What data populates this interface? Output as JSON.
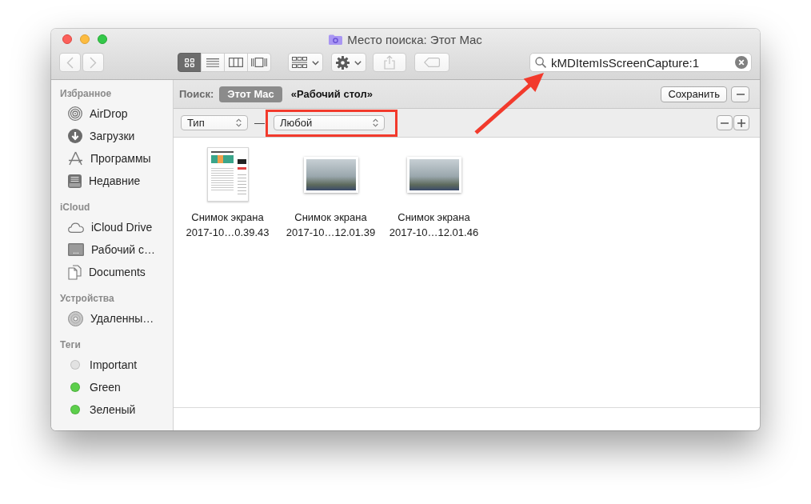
{
  "window": {
    "title": "Место поиска: Этот Mac"
  },
  "toolbar": {
    "nav": [
      {
        "kind": "back",
        "disabled": true
      },
      {
        "kind": "forward",
        "disabled": true
      }
    ],
    "views": [
      {
        "kind": "icons",
        "selected": true
      },
      {
        "kind": "list",
        "selected": false
      },
      {
        "kind": "columns",
        "selected": false
      },
      {
        "kind": "gallery",
        "selected": false
      }
    ],
    "buttons": [
      {
        "kind": "arrange",
        "disabled": false
      },
      {
        "kind": "action",
        "disabled": false
      },
      {
        "kind": "share",
        "disabled": true
      },
      {
        "kind": "tags",
        "disabled": true
      }
    ],
    "search": {
      "value": "kMDItemIsScreenCapture:1"
    }
  },
  "sidebar": {
    "sections": [
      {
        "title": "Избранное",
        "items": [
          {
            "label": "AirDrop",
            "kind": "airdrop"
          },
          {
            "label": "Загрузки",
            "kind": "downloads"
          },
          {
            "label": "Программы",
            "kind": "applications"
          },
          {
            "label": "Недавние",
            "kind": "recents"
          }
        ]
      },
      {
        "title": "iCloud",
        "items": [
          {
            "label": "iCloud Drive",
            "kind": "cloud"
          },
          {
            "label": "Рабочий с…",
            "kind": "desktop"
          },
          {
            "label": "Documents",
            "kind": "documents"
          }
        ]
      },
      {
        "title": "Устройства",
        "items": [
          {
            "label": "Удаленны…",
            "kind": "disc"
          }
        ]
      },
      {
        "title": "Теги",
        "items": [
          {
            "label": "Important",
            "kind": "tag",
            "color": "#e2e2e2"
          },
          {
            "label": "Green",
            "kind": "tag",
            "color": "#5ccf4b"
          },
          {
            "label": "Зеленый",
            "kind": "tag",
            "color": "#5ccf4b"
          }
        ]
      }
    ]
  },
  "scope_bar": {
    "label": "Поиск:",
    "scopes": [
      {
        "label": "Этот Mac",
        "selected": true
      },
      {
        "label": "«Рабочий стол»",
        "selected": false
      }
    ],
    "save_button": "Сохранить"
  },
  "criteria": [
    {
      "attribute": "Тип",
      "connector": "—",
      "value": "Любой"
    }
  ],
  "files": [
    {
      "name": "Снимок экрана 2017-10…0.39.43",
      "kind": "document"
    },
    {
      "name": "Снимок экрана 2017-10…12.01.39",
      "kind": "photo"
    },
    {
      "name": "Снимок экрана 2017-10…12.01.46",
      "kind": "photo"
    }
  ]
}
